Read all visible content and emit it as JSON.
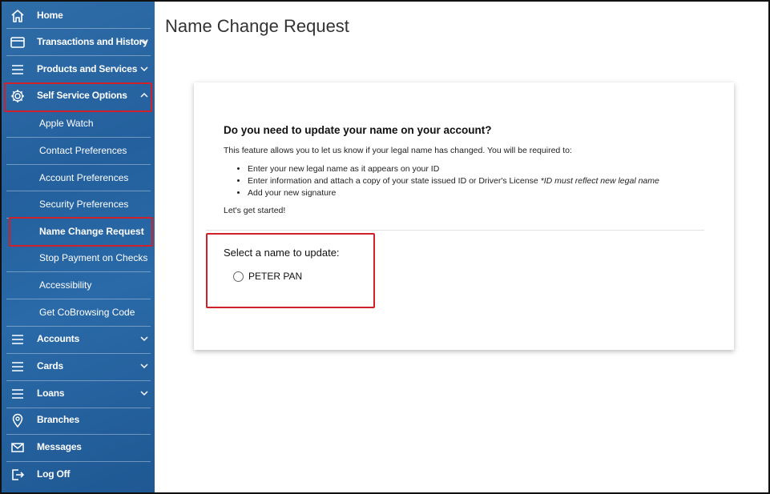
{
  "sidebar": {
    "items": [
      {
        "label": "Home",
        "icon": "home-icon"
      },
      {
        "label": "Transactions and History",
        "icon": "card-icon"
      },
      {
        "label": "Products and Services",
        "icon": "menu-icon"
      },
      {
        "label": "Self Service Options",
        "icon": "gear-icon"
      }
    ],
    "sub_items": [
      {
        "label": "Apple Watch"
      },
      {
        "label": "Contact Preferences"
      },
      {
        "label": "Account Preferences"
      },
      {
        "label": "Security Preferences"
      },
      {
        "label": "Name Change Request"
      },
      {
        "label": "Stop Payment on Checks"
      },
      {
        "label": "Accessibility"
      },
      {
        "label": "Get CoBrowsing Code"
      }
    ],
    "bottom_items": [
      {
        "label": "Accounts",
        "icon": "menu-icon"
      },
      {
        "label": "Cards",
        "icon": "menu-icon"
      },
      {
        "label": "Loans",
        "icon": "menu-icon"
      },
      {
        "label": "Branches",
        "icon": "location-icon"
      },
      {
        "label": "Messages",
        "icon": "mail-icon"
      },
      {
        "label": "Log Off",
        "icon": "logout-icon"
      }
    ]
  },
  "main": {
    "title": "Name Change Request",
    "card": {
      "heading": "Do you need to update your name on your account?",
      "intro": "This feature allows you to let us know if your legal name has changed. You will be required to:",
      "bullets": [
        "Enter your new legal name as it appears on your ID",
        "Enter information and attach a copy of your state issued ID or Driver's License",
        "Add your new signature"
      ],
      "bullet_note": "*ID must reflect new legal name",
      "start": "Let's get started!",
      "select_label": "Select a name to update:",
      "option": "PETER PAN"
    }
  },
  "colors": {
    "sidebar": "#2a67a4",
    "highlight": "#d0202a"
  }
}
